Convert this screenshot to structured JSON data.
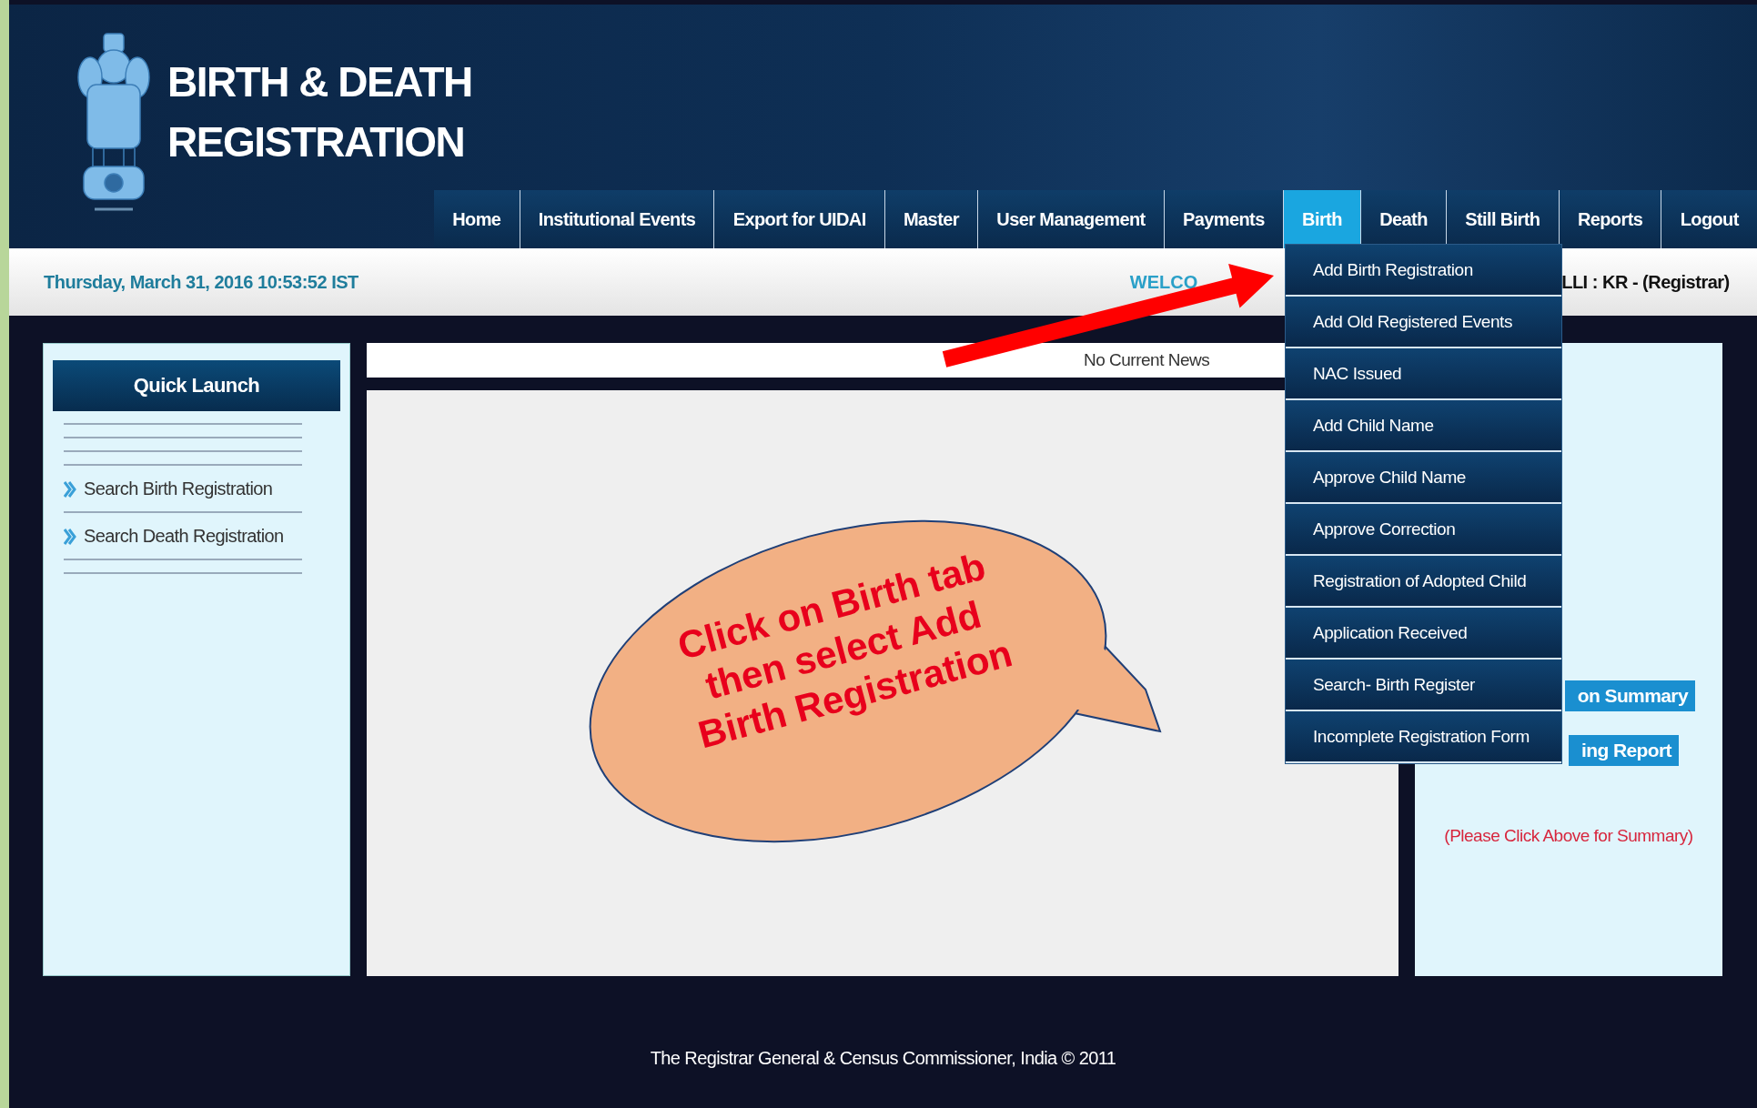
{
  "header": {
    "title_lines": [
      "BIRTH & DEATH",
      "REGISTRATION"
    ]
  },
  "nav": [
    {
      "label": "Home",
      "selected": false
    },
    {
      "label": "Institutional Events",
      "selected": false
    },
    {
      "label": "Export for UIDAI",
      "selected": false
    },
    {
      "label": "Master",
      "selected": false
    },
    {
      "label": "User Management",
      "selected": false
    },
    {
      "label": "Payments",
      "selected": false
    },
    {
      "label": "Birth",
      "selected": true
    },
    {
      "label": "Death",
      "selected": false
    },
    {
      "label": "Still Birth",
      "selected": false
    },
    {
      "label": "Reports",
      "selected": false
    },
    {
      "label": "Logout",
      "selected": false
    }
  ],
  "birth_menu": {
    "items": [
      "Add Birth Registration",
      "Add Old Registered Events",
      "NAC Issued",
      "Add Child Name",
      "Approve Child Name",
      "Approve Correction",
      "Registration of Adopted Child",
      "Application Received",
      "Search- Birth Register",
      "Incomplete Registration Form"
    ]
  },
  "info_bar": {
    "date": "Thursday, March 31, 2016 10:53:52 IST",
    "welcome_start": "WELCO",
    "welcome_end": "LLI : KR -  (Registrar)"
  },
  "quick_launch": {
    "title": "Quick Launch",
    "items": [
      "Search Birth Registration",
      "Search Death Registration"
    ]
  },
  "news": "No Current News",
  "right_panel": {
    "buttons": [
      "on Summary",
      "ing Report"
    ],
    "note": "(Please Click Above for Summary)"
  },
  "callout": "Click on Birth tab then select Add Birth Registration",
  "footer": "The Registrar General & Census Commissioner, India © 2011"
}
